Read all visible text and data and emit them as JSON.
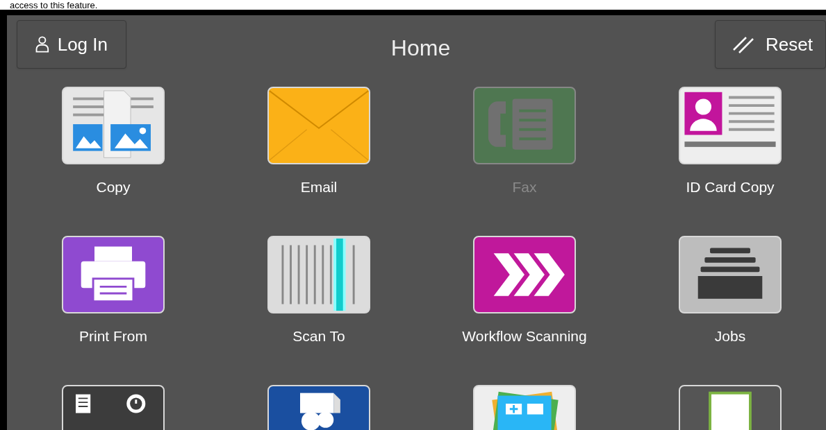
{
  "caption": "access to this feature.",
  "header": {
    "login": "Log In",
    "title": "Home",
    "reset": "Reset"
  },
  "apps": [
    {
      "kind": "copy",
      "label": "Copy",
      "disabled": false
    },
    {
      "kind": "email",
      "label": "Email",
      "disabled": false
    },
    {
      "kind": "fax",
      "label": "Fax",
      "disabled": true
    },
    {
      "kind": "idcard",
      "label": "ID Card Copy",
      "disabled": false
    },
    {
      "kind": "print",
      "label": "Print From",
      "disabled": false
    },
    {
      "kind": "scan",
      "label": "Scan To",
      "disabled": false
    },
    {
      "kind": "workflow",
      "label": "Workflow Scanning",
      "disabled": false
    },
    {
      "kind": "jobs",
      "label": "Jobs",
      "disabled": false
    },
    {
      "kind": "device",
      "disabled": false
    },
    {
      "kind": "cloud",
      "disabled": false
    },
    {
      "kind": "calc",
      "disabled": false
    },
    {
      "kind": "xmpie",
      "disabled": false
    }
  ]
}
